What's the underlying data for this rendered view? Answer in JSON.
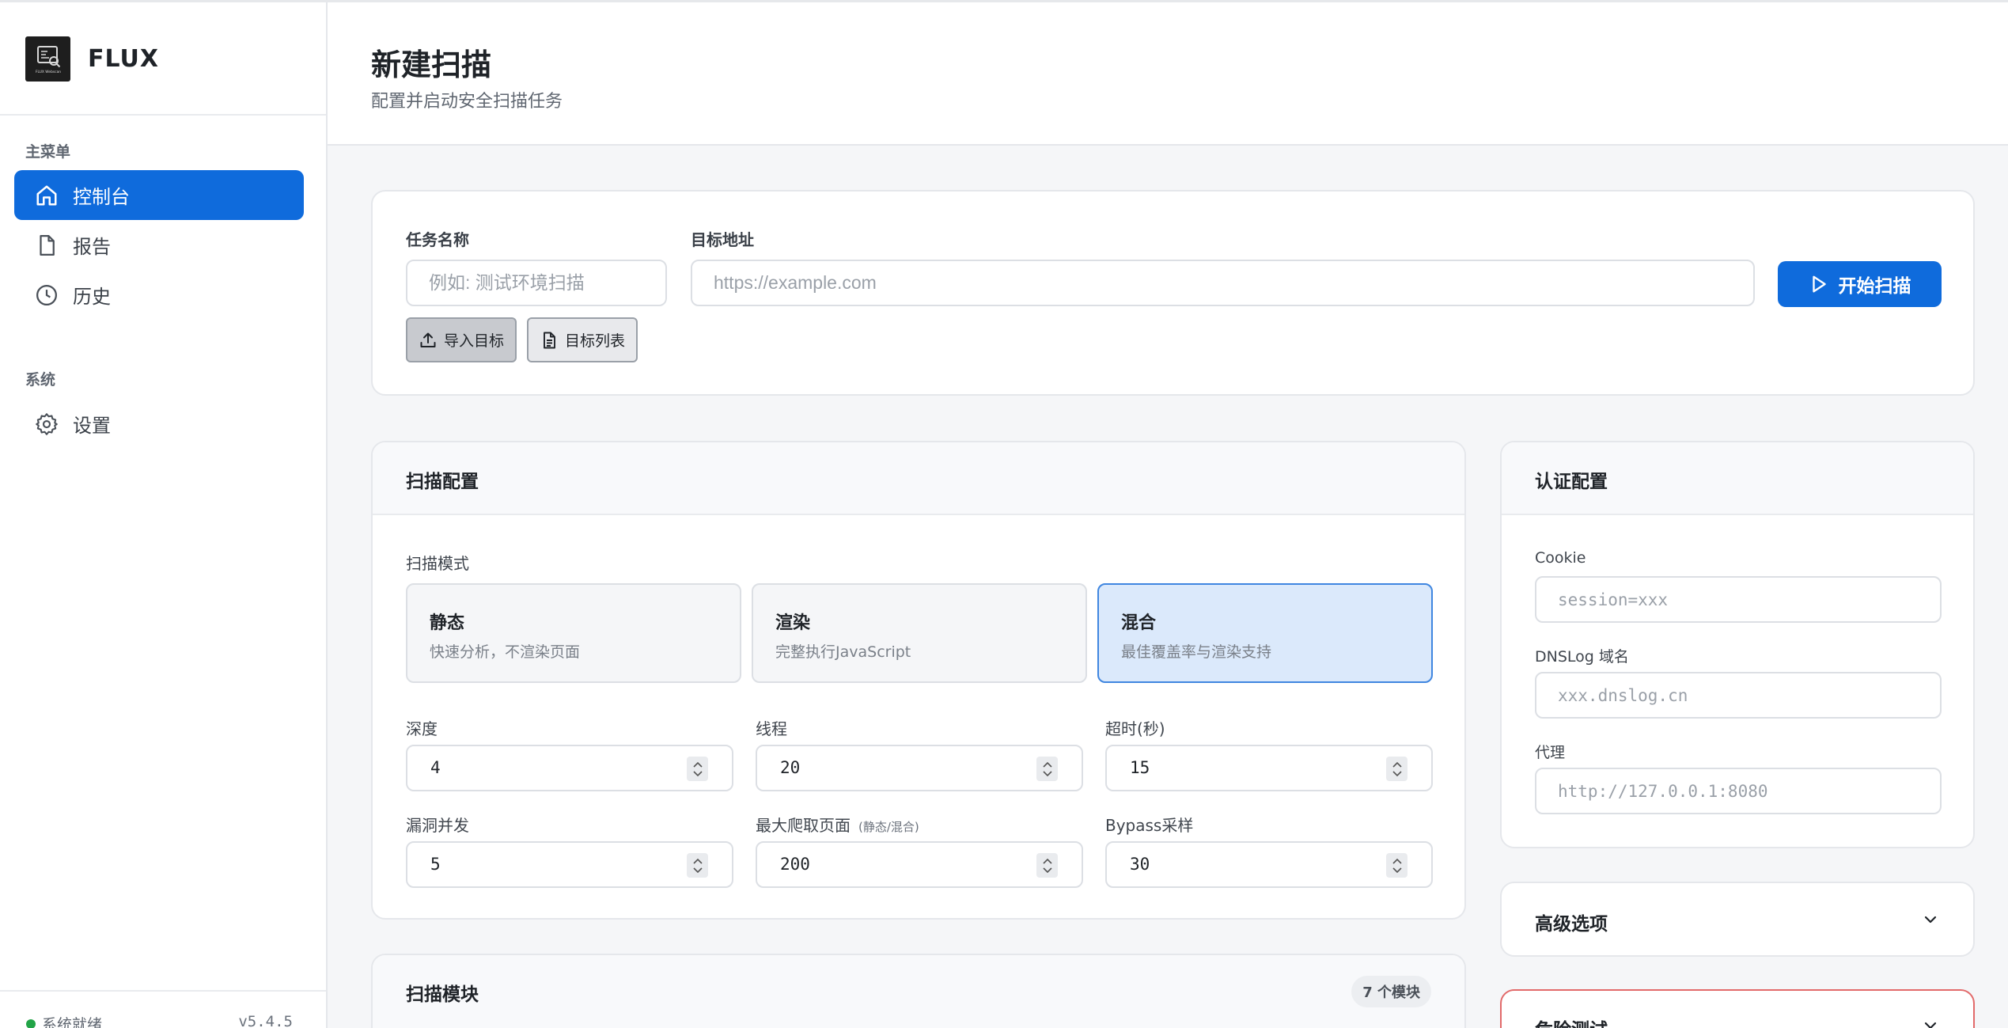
{
  "app": {
    "brand": "FLUX",
    "logo_text": "FLUX Webscan"
  },
  "sidebar": {
    "sections": [
      {
        "title": "主菜单"
      },
      {
        "title": "系统"
      }
    ],
    "items": [
      {
        "label": "控制台",
        "icon": "home-icon",
        "active": true
      },
      {
        "label": "报告",
        "icon": "file-icon",
        "active": false
      },
      {
        "label": "历史",
        "icon": "clock-icon",
        "active": false
      },
      {
        "label": "设置",
        "icon": "gear-icon",
        "active": false
      }
    ],
    "footer": {
      "status": "系统就绪",
      "version": "v5.4.5"
    }
  },
  "header": {
    "title": "新建扫描",
    "subtitle": "配置并启动安全扫描任务"
  },
  "task": {
    "name_label": "任务名称",
    "name_placeholder": "例如: 测试环境扫描",
    "target_label": "目标地址",
    "target_placeholder": "https://example.com",
    "start_button": "开始扫描",
    "import_button": "导入目标",
    "list_button": "目标列表"
  },
  "scan_config": {
    "title": "扫描配置",
    "mode_label": "扫描模式",
    "modes": [
      {
        "title": "静态",
        "desc": "快速分析，不渲染页面",
        "selected": false
      },
      {
        "title": "渲染",
        "desc": "完整执行JavaScript",
        "selected": false
      },
      {
        "title": "混合",
        "desc": "最佳覆盖率与渲染支持",
        "selected": true
      }
    ],
    "fields": [
      {
        "label": "深度",
        "value": "4"
      },
      {
        "label": "线程",
        "value": "20"
      },
      {
        "label": "超时(秒)",
        "value": "15"
      },
      {
        "label": "漏洞并发",
        "value": "5"
      },
      {
        "label": "最大爬取页面",
        "hint": "(静态/混合)",
        "value": "200"
      },
      {
        "label": "Bypass采样",
        "value": "30"
      }
    ]
  },
  "auth": {
    "title": "认证配置",
    "cookie_label": "Cookie",
    "cookie_placeholder": "session=xxx",
    "dnslog_label": "DNSLog 域名",
    "dnslog_placeholder": "xxx.dnslog.cn",
    "proxy_label": "代理",
    "proxy_placeholder": "http://127.0.0.1:8080"
  },
  "advanced": {
    "title": "高级选项"
  },
  "danger": {
    "title": "危险测试"
  },
  "modules": {
    "title": "扫描模块",
    "count": "7 个模块"
  },
  "colors": {
    "accent": "#0f6bdc",
    "selected_bg": "#dbe9fb",
    "danger_border": "#e26a6a",
    "status_ok": "#22a447"
  }
}
